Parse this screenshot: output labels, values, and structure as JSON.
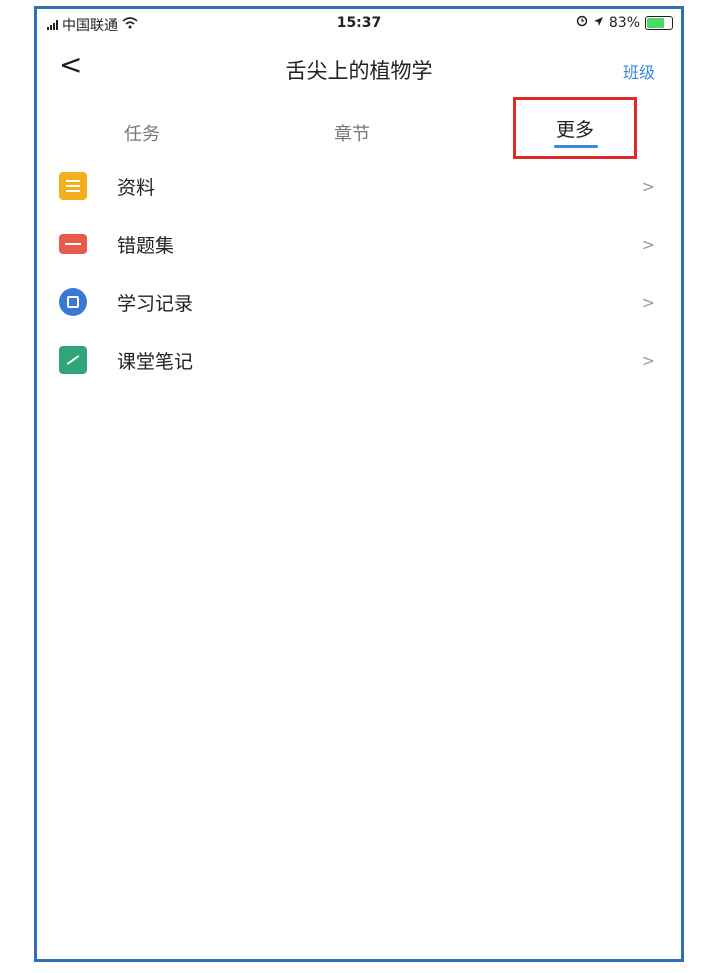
{
  "status_bar": {
    "carrier": "中国联通",
    "time": "15:37",
    "battery": "83%",
    "battery_level": 0.83
  },
  "nav": {
    "back_glyph": "<",
    "title": "舌尖上的植物学",
    "action_label": "班级"
  },
  "tabs": [
    {
      "label": "任务"
    },
    {
      "label": "章节"
    },
    {
      "label": "更多",
      "selected": true
    }
  ],
  "colors": {
    "accent": "#3a88d8",
    "highlight_box": "#e02a2a",
    "frame": "#2f6fb5"
  },
  "list": [
    {
      "label": "资料",
      "icon": "document-icon",
      "color": "#f3b01e"
    },
    {
      "label": "错题集",
      "icon": "error-set-icon",
      "color": "#ea5a4a"
    },
    {
      "label": "学习记录",
      "icon": "study-record-icon",
      "color": "#3a78d8"
    },
    {
      "label": "课堂笔记",
      "icon": "class-notes-icon",
      "color": "#2fa67a"
    }
  ],
  "chevron": ">"
}
